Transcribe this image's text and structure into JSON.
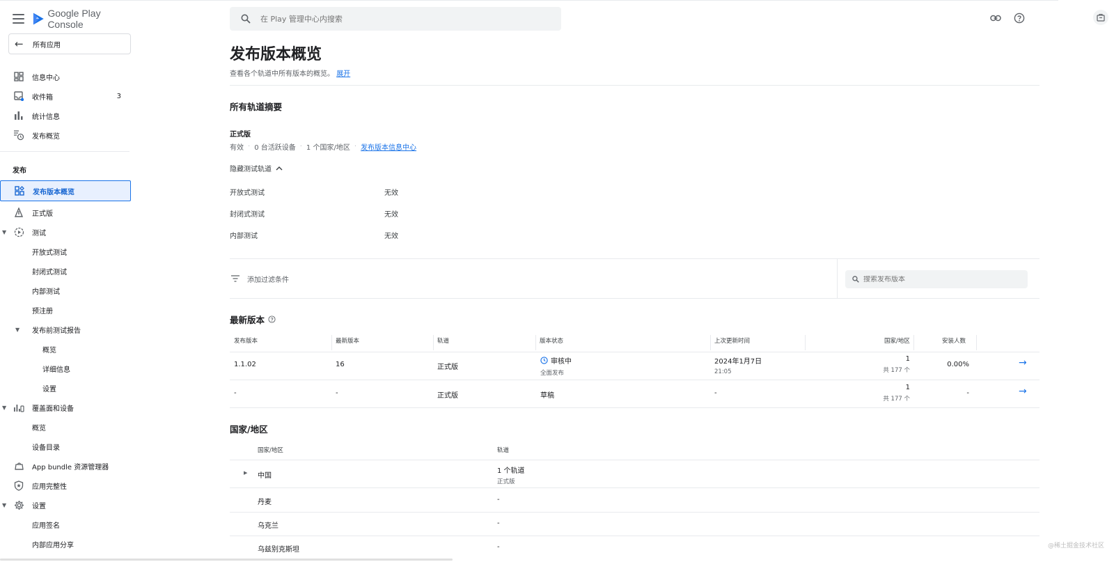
{
  "app": {
    "brand_prefix": "Google Play",
    "brand_suffix": "Console"
  },
  "sidebar": {
    "back_label": "所有应用",
    "top_items": [
      {
        "label": "信息中心",
        "icon": "dashboard-icon"
      },
      {
        "label": "收件箱",
        "icon": "inbox-icon",
        "badge": "3"
      },
      {
        "label": "统计信息",
        "icon": "bar-chart-icon"
      },
      {
        "label": "发布概览",
        "icon": "publishing-overview-icon"
      }
    ],
    "section_release": "发布",
    "release_items": [
      {
        "label": "发布版本概览",
        "icon": "release-overview-icon",
        "active": true
      },
      {
        "label": "正式版",
        "icon": "production-icon"
      },
      {
        "label": "测试",
        "icon": "testing-icon"
      },
      {
        "label": "开放式测试"
      },
      {
        "label": "封闭式测试"
      },
      {
        "label": "内部测试"
      },
      {
        "label": "预注册"
      },
      {
        "label": "发布前测试报告"
      },
      {
        "label": "概览"
      },
      {
        "label": "详细信息"
      },
      {
        "label": "设置"
      },
      {
        "label": "覆盖面和设备",
        "icon": "reach-devices-icon"
      },
      {
        "label": "概览"
      },
      {
        "label": "设备目录"
      },
      {
        "label": "App bundle 资源管理器",
        "icon": "app-bundle-icon"
      },
      {
        "label": "应用完整性",
        "icon": "app-integrity-icon"
      },
      {
        "label": "设置",
        "icon": "settings-gear-icon"
      },
      {
        "label": "应用签名"
      },
      {
        "label": "内部应用分享"
      }
    ]
  },
  "search": {
    "placeholder": "在 Play 管理中心内搜索"
  },
  "page": {
    "title": "发布版本概览",
    "subtitle": "查看各个轨道中所有版本的概览。",
    "expand_link": "展开"
  },
  "summary": {
    "heading": "所有轨道摘要",
    "production_title": "正式版",
    "status": "有效",
    "devices": "0 台活跃设备",
    "countries": "1 个国家/地区",
    "dashboard_link": "发布版本信息中心",
    "hide_tracks": "隐藏测试轨道",
    "tracks": [
      {
        "name": "开放式测试",
        "status": "无效"
      },
      {
        "name": "封闭式测试",
        "status": "无效"
      },
      {
        "name": "内部测试",
        "status": "无效"
      }
    ]
  },
  "filter": {
    "add_filter": "添加过滤条件",
    "search_placeholder": "搜索发布版本"
  },
  "releases": {
    "heading": "最新版本",
    "columns": [
      "发布版本",
      "最新版本",
      "轨道",
      "版本状态",
      "上次更新时间",
      "国家/地区",
      "安装人数"
    ],
    "rows": [
      {
        "release": "1.1.02",
        "latest": "16",
        "track": "正式版",
        "status": "审核中",
        "status_sub": "全面发布",
        "updated": "2024年1月7日",
        "updated_time": "21:05",
        "countries": "1",
        "countries_sub": "共 177 个",
        "installs": "0.00%"
      },
      {
        "release": "-",
        "latest": "-",
        "track": "正式版",
        "status": "草稿",
        "status_sub": "",
        "updated": "-",
        "updated_time": "",
        "countries": "1",
        "countries_sub": "共 177 个",
        "installs": "-"
      }
    ]
  },
  "countries": {
    "heading": "国家/地区",
    "columns": [
      "国家/地区",
      "轨道"
    ],
    "rows": [
      {
        "name": "中国",
        "track": "1 个轨道",
        "track_sub": "正式版"
      },
      {
        "name": "丹麦",
        "track": "-",
        "track_sub": ""
      },
      {
        "name": "乌克兰",
        "track": "-",
        "track_sub": ""
      },
      {
        "name": "乌兹别克斯坦",
        "track": "-",
        "track_sub": ""
      }
    ]
  },
  "watermark": "@稀土掘金技术社区",
  "colors": {
    "accent": "#1a73e8",
    "active_bg": "#e8f0fe",
    "divider": "#e8eaed"
  }
}
